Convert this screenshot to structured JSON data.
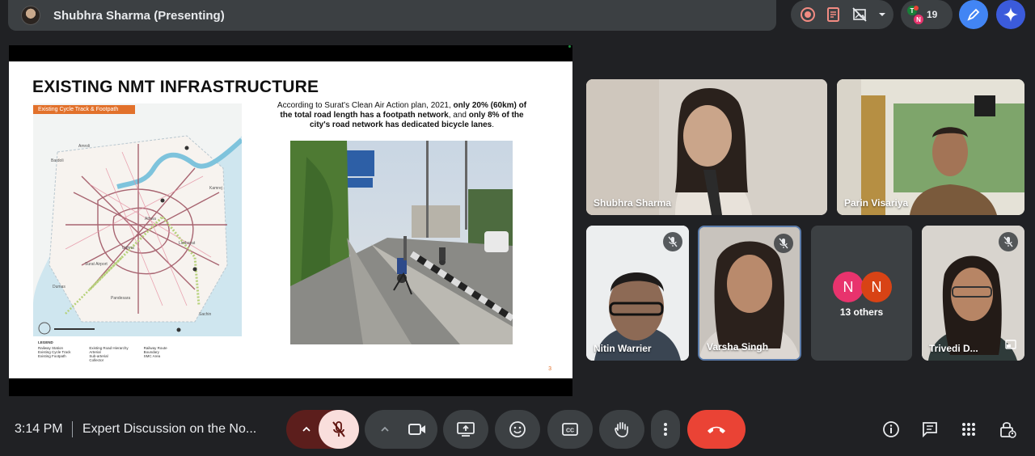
{
  "presenter": {
    "name": "Shubhra Sharma (Presenting)"
  },
  "top_controls": {
    "participant_count": "19",
    "mini_avatars": [
      "T",
      "N"
    ],
    "icons": [
      "record-icon",
      "note-icon",
      "no-image-icon",
      "chevron-down-icon"
    ]
  },
  "slide": {
    "title": "EXISTING NMT INFRASTRUCTURE",
    "map_tag": "Existing Cycle Track & Footpath",
    "map_labels": [
      "Amroli",
      "Athwa",
      "Bardoli",
      "Sachin",
      "Dumas",
      "Surat Airport",
      "Kamrej",
      "Limbayat",
      "Udhna",
      "Pandesara"
    ],
    "text_before": "According to Surat's Clean Air Action plan, 2021, ",
    "text_bold1": "only 20% (60km) of the total road length has a footpath network",
    "text_mid": ", and ",
    "text_bold2": "only 8% of the city's road network has dedicated bicycle lanes",
    "text_end": ".",
    "legend_title": "LEGEND",
    "legend_items": [
      "Railway Station",
      "Existing Cycle Track",
      "Existing Footpath",
      "Existing Road Hierarchy",
      "Arterial",
      "Sub-arterial",
      "Collector",
      "Railway Route",
      "Boundary",
      "SMC Area"
    ],
    "page_number": "3"
  },
  "participants": [
    {
      "name": "Shubhra Sharma",
      "muted": false
    },
    {
      "name": "Parin Visariya",
      "muted": false
    },
    {
      "name": "Nitin Warrier",
      "muted": true
    },
    {
      "name": "Varsha Singh",
      "muted": true
    },
    {
      "name": "Trivedi D...",
      "muted": true
    }
  ],
  "others": {
    "label": "13 others",
    "avatars": [
      "N",
      "N"
    ],
    "colors": [
      "#e8336d",
      "#d84315"
    ]
  },
  "bottom_bar": {
    "time": "3:14 PM",
    "meeting_title": "Expert Discussion on the No..."
  },
  "colors": {
    "background": "#202124",
    "panel": "#3c4043",
    "hangup": "#ea4335",
    "mic_off_bg": "#f9dedc"
  }
}
